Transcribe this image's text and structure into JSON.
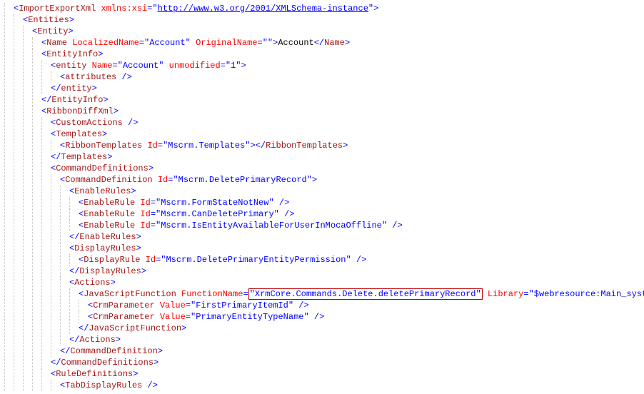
{
  "tokens": {
    "lt": "<",
    "gt": ">",
    "slash": "/",
    "ltSlash": "</",
    "selfClose": " />",
    "eq": "=",
    "q": "\""
  },
  "tags": {
    "ImportExportXml": "ImportExportXml",
    "Entities": "Entities",
    "Entity": "Entity",
    "Name": "Name",
    "EntityInfo": "EntityInfo",
    "entity": "entity",
    "attributes": "attributes",
    "RibbonDiffXml": "RibbonDiffXml",
    "CustomActions": "CustomActions",
    "Templates": "Templates",
    "RibbonTemplates": "RibbonTemplates",
    "CommandDefinitions": "CommandDefinitions",
    "CommandDefinition": "CommandDefinition",
    "EnableRules": "EnableRules",
    "EnableRule": "EnableRule",
    "DisplayRules": "DisplayRules",
    "DisplayRule": "DisplayRule",
    "Actions": "Actions",
    "JavaScriptFunction": "JavaScriptFunction",
    "CrmParameter": "CrmParameter",
    "RuleDefinitions": "RuleDefinitions",
    "TabDisplayRules": "TabDisplayRules"
  },
  "attrs": {
    "xmlns_xsi": "xmlns:xsi",
    "LocalizedName": "LocalizedName",
    "OriginalName": "OriginalName",
    "NameAttr": "Name",
    "unmodified": "unmodified",
    "Id": "Id",
    "FunctionName": "FunctionName",
    "Library": "Library",
    "Value": "Value"
  },
  "values": {
    "xsi_uri": "http://www.w3.org/2001/XMLSchema-instance",
    "Account": "Account",
    "empty": "",
    "one": "1",
    "MscrmTemplates": "Mscrm.Templates",
    "MscrmDeletePrimaryRecord": "Mscrm.DeletePrimaryRecord",
    "MscrmFormStateNotNew": "Mscrm.FormStateNotNew",
    "MscrmCanDeletePrimary": "Mscrm.CanDeletePrimary",
    "MscrmIsEntityAvailableForUserInMocaOffline": "Mscrm.IsEntityAvailableForUserInMocaOffline",
    "MscrmDeletePrimaryEntityPermission": "Mscrm.DeletePrimaryEntityPermission",
    "XrmCoreDelete": "XrmCore.Commands.Delete.deletePrimaryRecord",
    "LibraryVal": "$webresource:Main_system_library.js",
    "FirstPrimaryItemId": "FirstPrimaryItemId",
    "PrimaryEntityTypeName": "PrimaryEntityTypeName"
  },
  "text": {
    "AccountText": "Account"
  }
}
